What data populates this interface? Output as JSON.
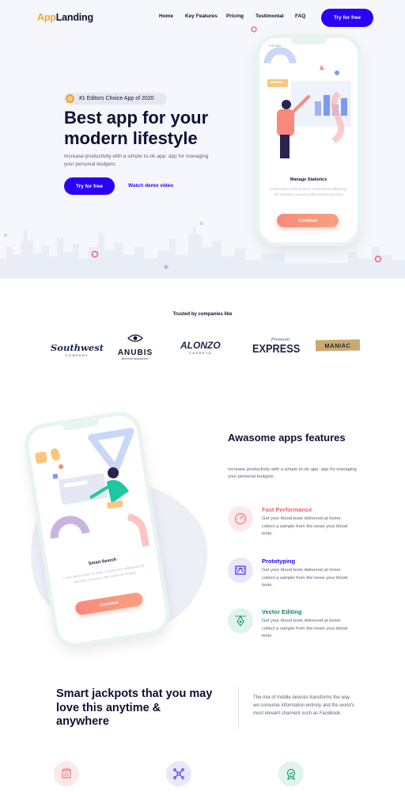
{
  "nav": {
    "logo_part1": "App",
    "logo_part2": "Landing",
    "items": [
      {
        "label": "Home"
      },
      {
        "label": "Key Features"
      },
      {
        "label": "Pricing"
      },
      {
        "label": "Testimonial"
      },
      {
        "label": "FAQ"
      }
    ],
    "cta_label": "Try for free"
  },
  "hero": {
    "badge_text": "#1 Editors Choice App of 2020",
    "title": "Best app for your modern lifestyle",
    "description": "Increase productivity with a simple to-do app. app for managing your personal budgets.",
    "cta_label": "Try for free",
    "demo_label": "Watch demo video",
    "phone": {
      "status_time": "9:41 AM",
      "title": "Manage Statistics",
      "text": "Lorem ipsum dolor sit amet, consectetuer adipiscing elit, sed diam nonummy nibh euismod tincidunt",
      "button_label": "Continue"
    }
  },
  "trusted": {
    "title": "Trusted by companies like",
    "brands": [
      {
        "name": "Southwest",
        "sub": "COMPANY"
      },
      {
        "name": "ANUBIS",
        "sub": "EGYPTIAN TECHNOLOGY"
      },
      {
        "name": "ALONZO",
        "sub": "CASSETA"
      },
      {
        "name": "EXPRESS",
        "prefix": "Premium"
      },
      {
        "name": "MANIAC"
      }
    ]
  },
  "features": {
    "title": "Awasome apps features",
    "description": "Increase productivity with a simple to-do app. app for managing your personal budgets.",
    "phone": {
      "title": "Smart Search",
      "text": "Lorem ipsum dolor sit amet, consectetuer adipiscing elit, sed diam nonummy nibh euismod tincidunt",
      "button_label": "Continue"
    },
    "items": [
      {
        "title": "Fast Performance",
        "text": "Get your blood tests delivered at home collect a sample from the news your blood tests.",
        "color": "#f55f6e",
        "icon": "speedometer-icon"
      },
      {
        "title": "Prototyping",
        "text": "Get your blood tests delivered at home collect a sample from the news your blood tests.",
        "color": "#2b00f7",
        "icon": "blueprint-icon"
      },
      {
        "title": "Vector Editing",
        "text": "Get your blood tests delivered at home collect a sample from the news your blood tests.",
        "color": "#0b8a5e",
        "icon": "pen-tool-icon"
      }
    ]
  },
  "jackpots": {
    "title": "Smart jackpots that you may love this anytime & anywhere",
    "text": "The rise of mobile devices transforms the way we consume information entirely and the world's most elevant channels such as Facebook."
  },
  "colors": {
    "primary": "#2b00f7",
    "accent_orange": "#f3a936",
    "dark": "#0e1133",
    "coral": "#f78a7a"
  }
}
